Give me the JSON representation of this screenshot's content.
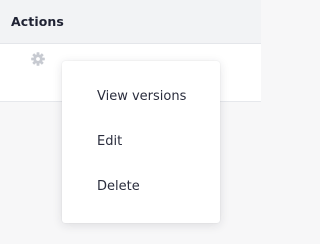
{
  "table": {
    "header_title": "Actions",
    "settings_icon": "gear-icon"
  },
  "menu": {
    "items": [
      {
        "label": "View versions"
      },
      {
        "label": "Edit"
      },
      {
        "label": "Delete"
      }
    ]
  }
}
